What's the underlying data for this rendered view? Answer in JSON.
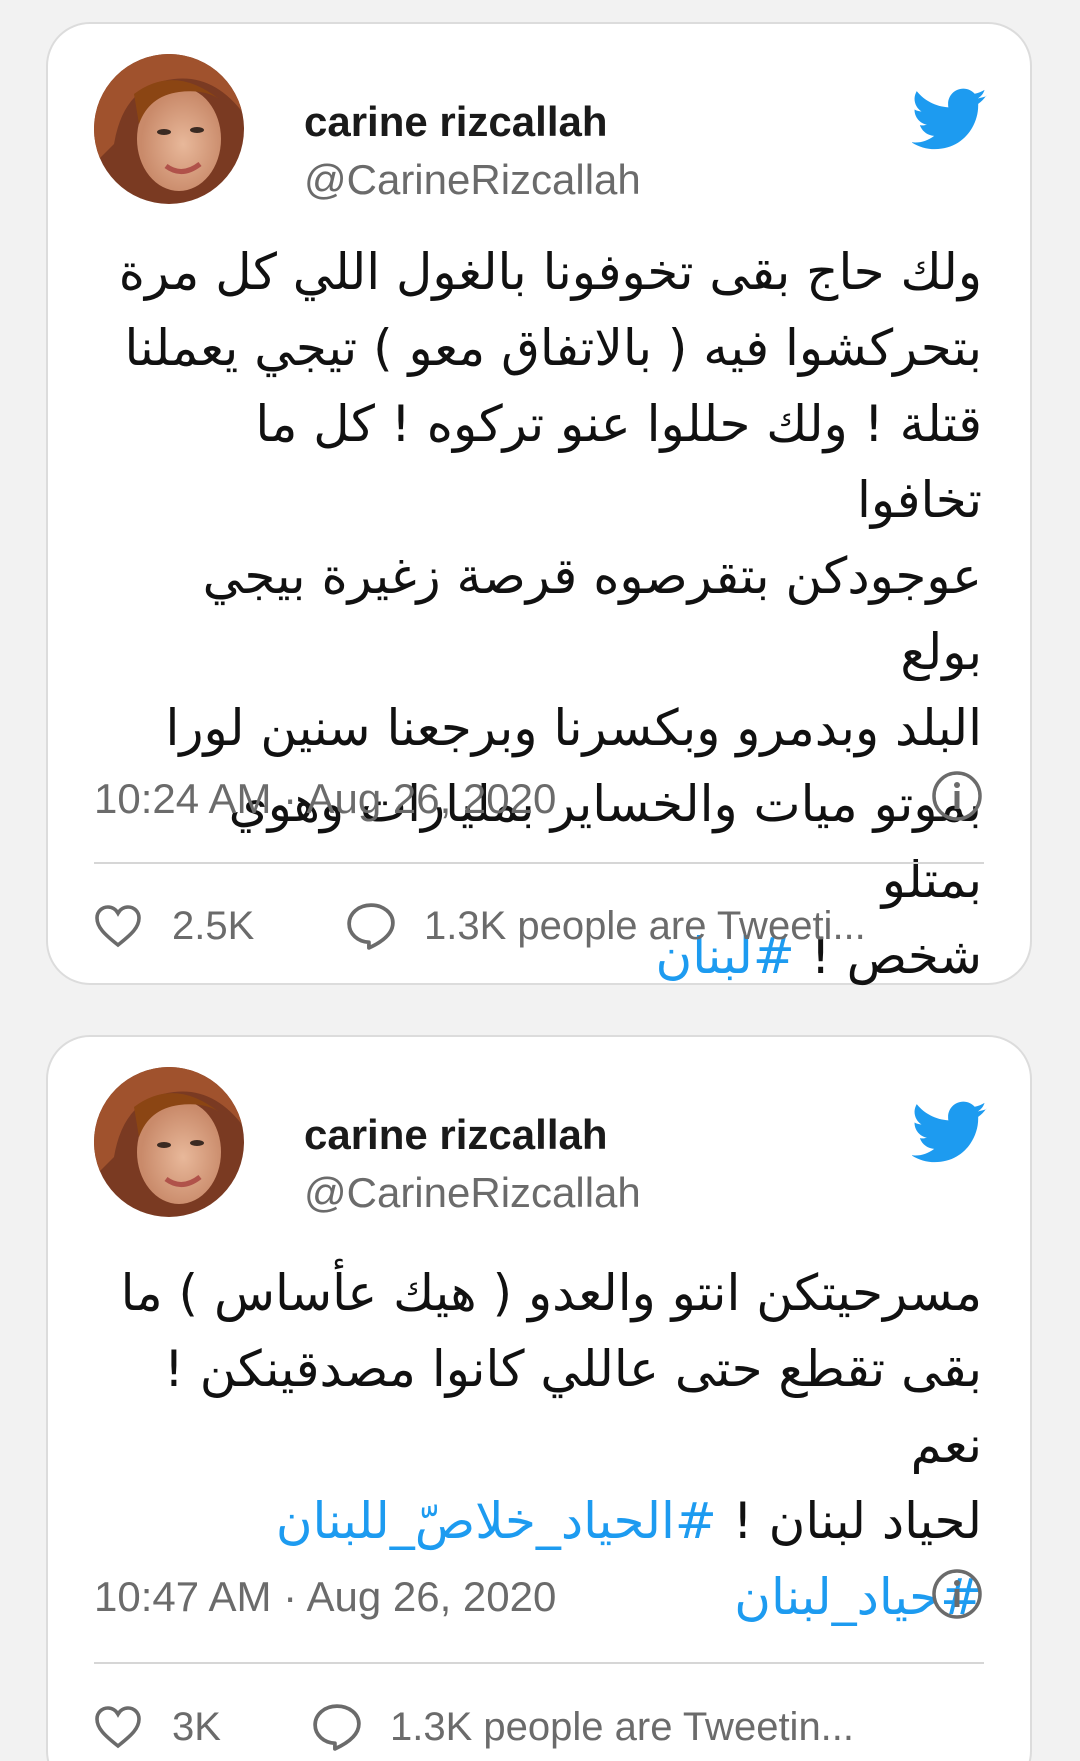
{
  "tweets": [
    {
      "author_name": "carine rizcallah",
      "author_handle": "@CarineRizcallah",
      "lines": [
        "ولك حاج بقى تخوفونا بالغول اللي كل مرة",
        "بتحركشوا فيه ( بالاتفاق معو ) تيجي يعملنا",
        "قتلة ! ولك حللوا عنو تركوه ! كل ما تخافوا",
        "عوجودكن بتقرصوه قرصة زغيرة بيجي بولع",
        "البلد وبدمرو وبكسرنا وبرجعنا سنين لورا",
        "بموتو ميات والخساير بمليارات وهوي بمتلو"
      ],
      "last_line_text": "شخص ! ",
      "hashtags": [
        "#لبنان"
      ],
      "timestamp": "10:24 AM · Aug 26, 2020",
      "likes": "2.5K",
      "people_tweeting": "1.3K people are Tweeti..."
    },
    {
      "author_name": "carine rizcallah",
      "author_handle": "@CarineRizcallah",
      "lines": [
        "مسرحيتكن انتو والعدو ( هيك عأساس ) ما",
        "بقى تقطع حتى عاللي كانوا مصدقينكن ! نعم"
      ],
      "last_line_text": "لحياد لبنان ! ",
      "hashtags": [
        "#الحياد_خلاصّ_للبنان",
        "#حياد_لبنان"
      ],
      "timestamp": "10:47 AM · Aug 26, 2020",
      "likes": "3K",
      "people_tweeting": "1.3K people are Tweetin..."
    }
  ],
  "colors": {
    "twitter_blue": "#1d9bf0",
    "muted_text": "#6b6b6b",
    "card_border": "#dcdcdc"
  },
  "icons": [
    "twitter-bird-icon",
    "info-icon",
    "heart-icon",
    "speech-bubble-icon"
  ]
}
